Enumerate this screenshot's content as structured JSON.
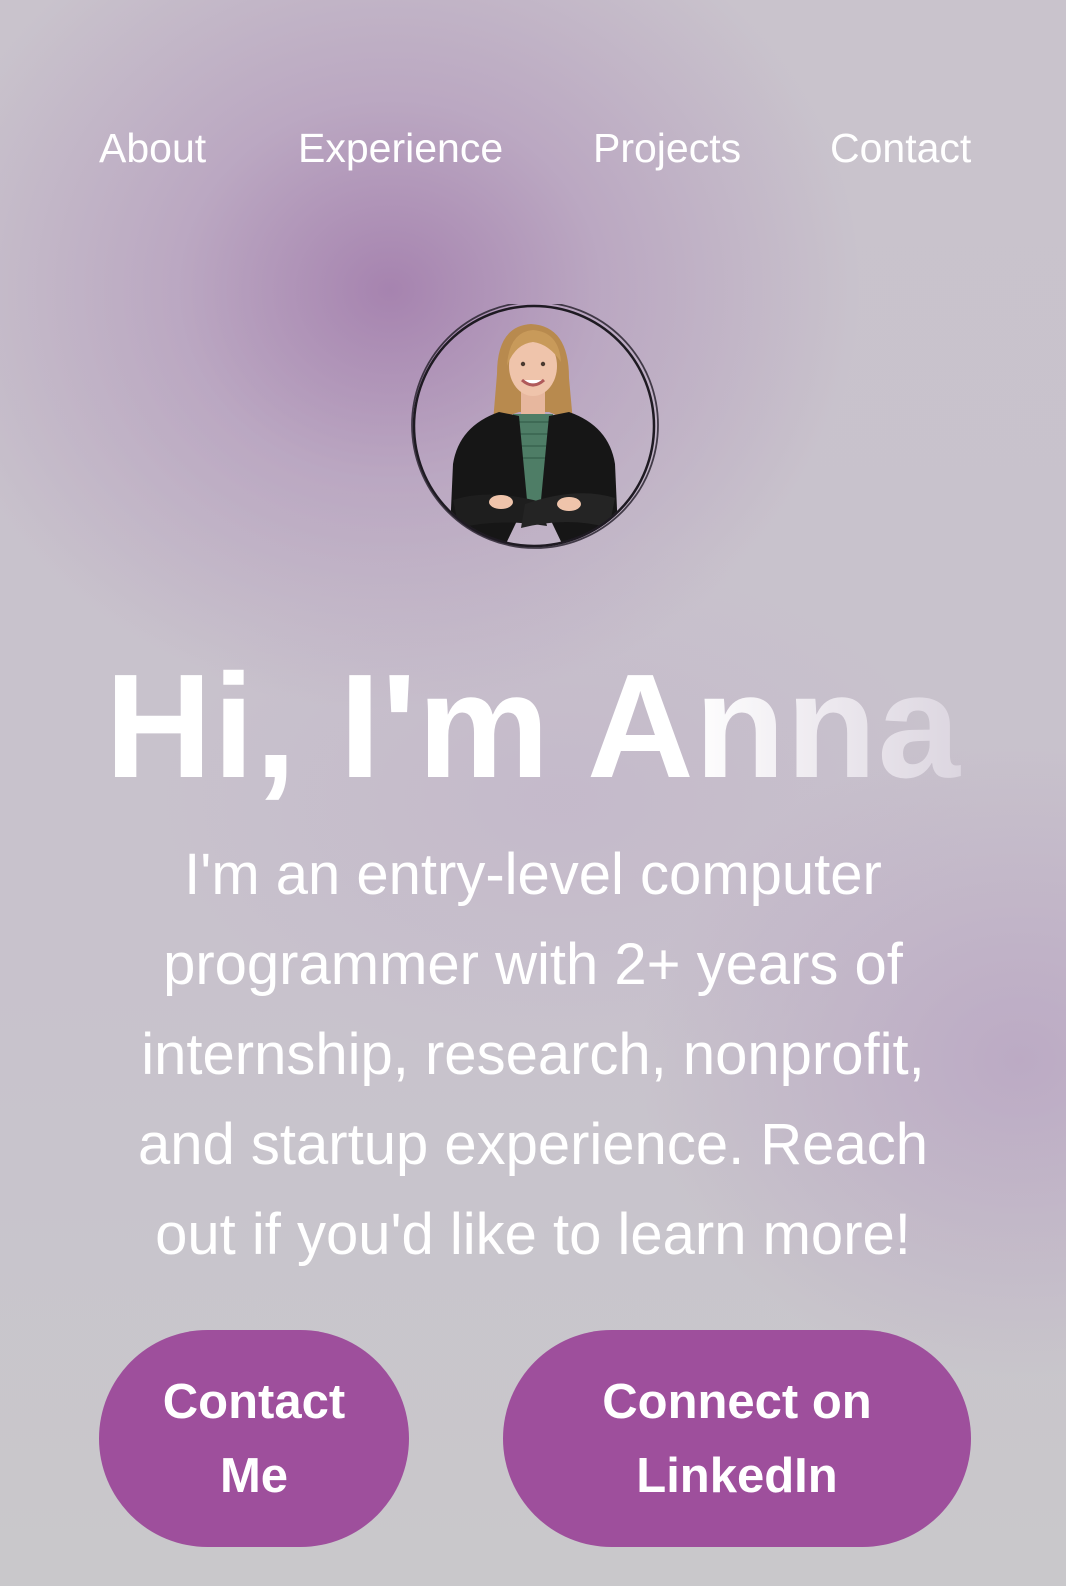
{
  "nav": {
    "items": [
      {
        "label": "About"
      },
      {
        "label": "Experience"
      },
      {
        "label": "Projects"
      },
      {
        "label": "Contact"
      }
    ]
  },
  "hero": {
    "avatar_alt": "Portrait of Anna",
    "title": "Hi, I'm Anna",
    "intro": "I'm an entry-level computer programmer with 2+ years of internship, research, nonprofit, and startup experience. Reach out if you'd like to learn more!"
  },
  "actions": {
    "contact_label": "Contact Me",
    "linkedin_label": "Connect on LinkedIn"
  },
  "colors": {
    "accent": "#9e4f9c",
    "text": "#ffffff",
    "background": "#cbc9cd"
  }
}
